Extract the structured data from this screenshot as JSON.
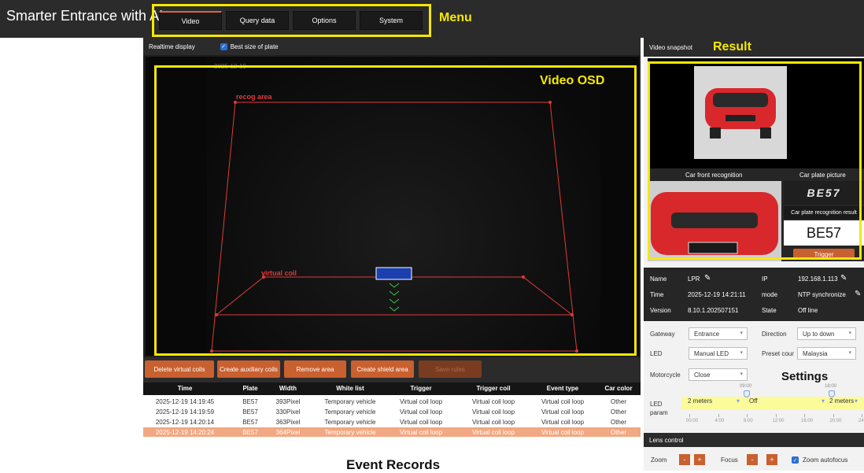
{
  "app": {
    "title": "Smarter Entrance with AI"
  },
  "menu": {
    "items": [
      "Video",
      "Query data",
      "Options",
      "System"
    ],
    "active": "Video"
  },
  "annotations": {
    "menu": "Menu",
    "result": "Result",
    "video_osd": "Video OSD",
    "settings": "Settings",
    "event_records": "Event Records"
  },
  "video": {
    "realtime_label": "Realtime display",
    "best_size_label": "Best size of plate",
    "best_size_checked": true,
    "timestamp": "2025-12-19",
    "recog_area_label": "recog area",
    "virtual_coil_label": "virtual coil"
  },
  "toolbar": {
    "buttons": [
      "Delete virtual coils",
      "Create auxiliary coils",
      "Remove area",
      "Create shield area",
      "Save rules"
    ]
  },
  "table": {
    "columns": [
      "Time",
      "Plate",
      "Width",
      "White list",
      "Trigger",
      "Trigger coil",
      "Event type",
      "Car color"
    ],
    "rows": [
      [
        "2025-12-19 14:19:45",
        "BE57",
        "393Pixel",
        "Temporary vehicle",
        "Virtual coil loop",
        "Virtual coil loop",
        "Virtual coil loop",
        "Other"
      ],
      [
        "2025-12-19 14:19:59",
        "BE57",
        "330Pixel",
        "Temporary vehicle",
        "Virtual coil loop",
        "Virtual coil loop",
        "Virtual coil loop",
        "Other"
      ],
      [
        "2025-12-19 14:20:14",
        "BE57",
        "363Pixel",
        "Temporary vehicle",
        "Virtual coil loop",
        "Virtual coil loop",
        "Virtual coil loop",
        "Other"
      ],
      [
        "2025-12-19 14:20:24",
        "BE57",
        "364Pixel",
        "Temporary vehicle",
        "Virtual coil loop",
        "Virtual coil loop",
        "Virtual coil loop",
        "Other"
      ]
    ],
    "highlight_color": "#f2a882"
  },
  "snapshot": {
    "header": "Video snapshot",
    "car_front_label": "Car front recognition",
    "plate_picture_label": "Car plate picture",
    "plate_result_label": "Car plate recognition result",
    "plate_image_text": "BE57",
    "plate_result": "BE57",
    "trigger_label": "Trigger"
  },
  "device": {
    "name_label": "Name",
    "name_value": "LPR",
    "ip_label": "IP",
    "ip_value": "192.168.1.113",
    "time_label": "Time",
    "time_value": "2025-12-19 14:21:11",
    "mode_label": "mode",
    "mode_value": "NTP synchronize",
    "version_label": "Version",
    "version_value": "8.10.1.202507151",
    "state_label": "State",
    "state_value": "Off line"
  },
  "settings": {
    "gateway_label": "Gateway",
    "gateway_value": "Entrance",
    "direction_label": "Direction",
    "direction_value": "Up to down",
    "led_label": "LED",
    "led_value": "Manual LED",
    "preset_label": "Preset cour",
    "preset_value": "Malaysia",
    "motorcycle_label": "Motorcycle",
    "motorcycle_value": "Close",
    "led_param_label": "LED\nparam",
    "led_param_left": "2 meters",
    "led_param_mid": "Off",
    "led_param_right": "2 meters",
    "handle_labels": [
      "09:00",
      "18:00"
    ],
    "ticks": [
      "00:00",
      "4:00",
      "8:00",
      "12:00",
      "16:00",
      "20:00",
      "24:00"
    ]
  },
  "lens": {
    "header": "Lens control",
    "zoom_label": "Zoom",
    "focus_label": "Focus",
    "minus": "-",
    "plus": "+",
    "autofocus_label": "Zoom autofocus",
    "autofocus_checked": true
  },
  "colors": {
    "accent": "#c8602f",
    "annotation": "#f5e800",
    "osd_line": "#e03a3a"
  }
}
